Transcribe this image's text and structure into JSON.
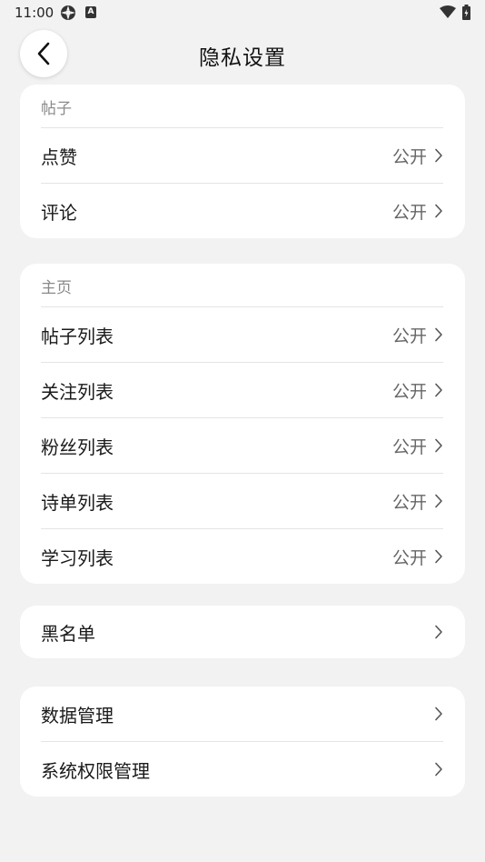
{
  "status": {
    "time": "11:00",
    "a_badge": "A"
  },
  "header": {
    "title": "隐私设置"
  },
  "post_section": {
    "label": "帖子",
    "items": [
      {
        "label": "点赞",
        "value": "公开"
      },
      {
        "label": "评论",
        "value": "公开"
      }
    ]
  },
  "home_section": {
    "label": "主页",
    "items": [
      {
        "label": "帖子列表",
        "value": "公开"
      },
      {
        "label": "关注列表",
        "value": "公开"
      },
      {
        "label": "粉丝列表",
        "value": "公开"
      },
      {
        "label": "诗单列表",
        "value": "公开"
      },
      {
        "label": "学习列表",
        "value": "公开"
      }
    ]
  },
  "blacklist": {
    "label": "黑名单"
  },
  "data_section": {
    "items": [
      {
        "label": "数据管理"
      },
      {
        "label": "系统权限管理"
      }
    ]
  },
  "colors": {
    "background": "#f2f2f2",
    "card": "#ffffff",
    "value_text": "#666666",
    "section_label": "#8a8a8a"
  },
  "icons": [
    "back-arrow-icon",
    "chevron-right-icon",
    "wifi-icon",
    "battery-icon",
    "gear-icon"
  ]
}
